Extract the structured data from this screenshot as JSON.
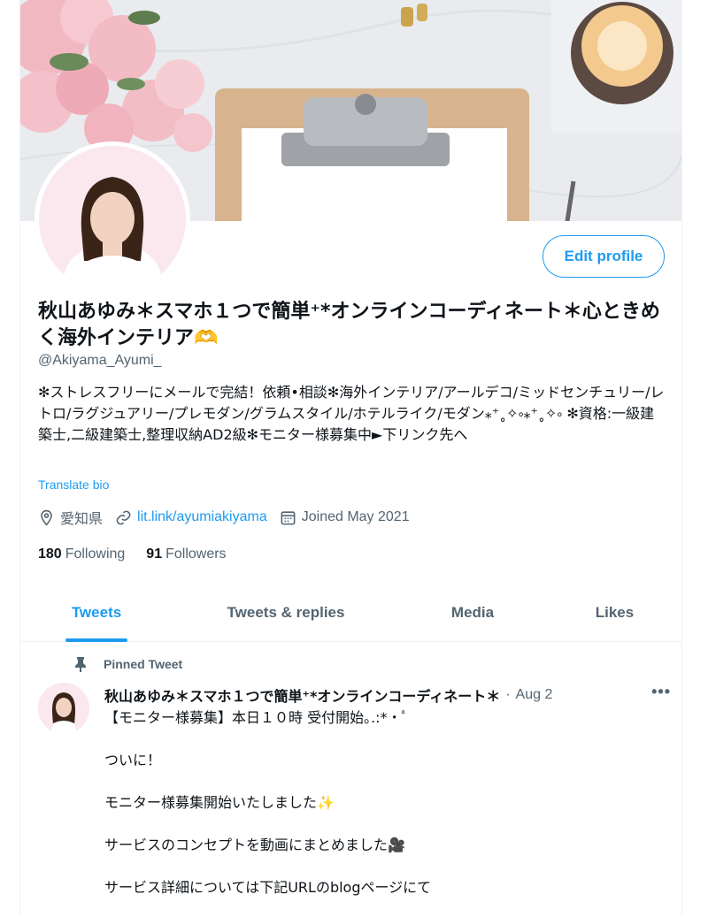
{
  "profile": {
    "edit_label": "Edit profile",
    "name": "秋山あゆみ＊スマホ１つで簡単⁺*オンラインコーディネート＊心ときめく海外インテリア🫶",
    "handle": "@Akiyama_Ayumi_",
    "bio": "✻ストレスフリーにメールで完結！依頼•相談✻海外インテリア/アールデコ/ミッドセンチュリー/レトロ/ラグジュアリー/プレモダン/グラムスタイル/ホテルライク/モダン⁎⁺˳✧༚⁎⁺˳✧༚ ✻資格:一級建築士,二級建築士,整理収納AD2級✻モニター様募集中►下リンク先へ",
    "translate_label": "Translate bio",
    "location": "愛知県",
    "link": "lit.link/ayumiakiyama",
    "joined": "Joined May 2021",
    "following_count": "180",
    "following_label": "Following",
    "followers_count": "91",
    "followers_label": "Followers"
  },
  "tabs": [
    {
      "label": "Tweets"
    },
    {
      "label": "Tweets & replies"
    },
    {
      "label": "Media"
    },
    {
      "label": "Likes"
    }
  ],
  "pinned": {
    "label": "Pinned Tweet",
    "author": "秋山あゆみ＊スマホ１つで簡単⁺*オンラインコーディネート＊",
    "separator": "·",
    "date": "Aug 2",
    "more": "•••",
    "lines": [
      "【モニター様募集】本日１０時 受付開始｡.:*・ﾟ",
      "",
      "ついに！",
      "",
      "モニター様募集開始いたしました✨",
      "",
      "サービスのコンセプトを動画にまとめました🎥",
      "",
      "サービス詳細については下記URLのblogページにて"
    ]
  },
  "colors": {
    "accent": "#1d9bf0",
    "secondary_text": "#536471",
    "primary_text": "#0f1419"
  },
  "icons": {
    "location": "location-pin-icon",
    "link": "link-icon",
    "calendar": "calendar-icon",
    "pin": "pin-icon",
    "more": "more-icon"
  }
}
